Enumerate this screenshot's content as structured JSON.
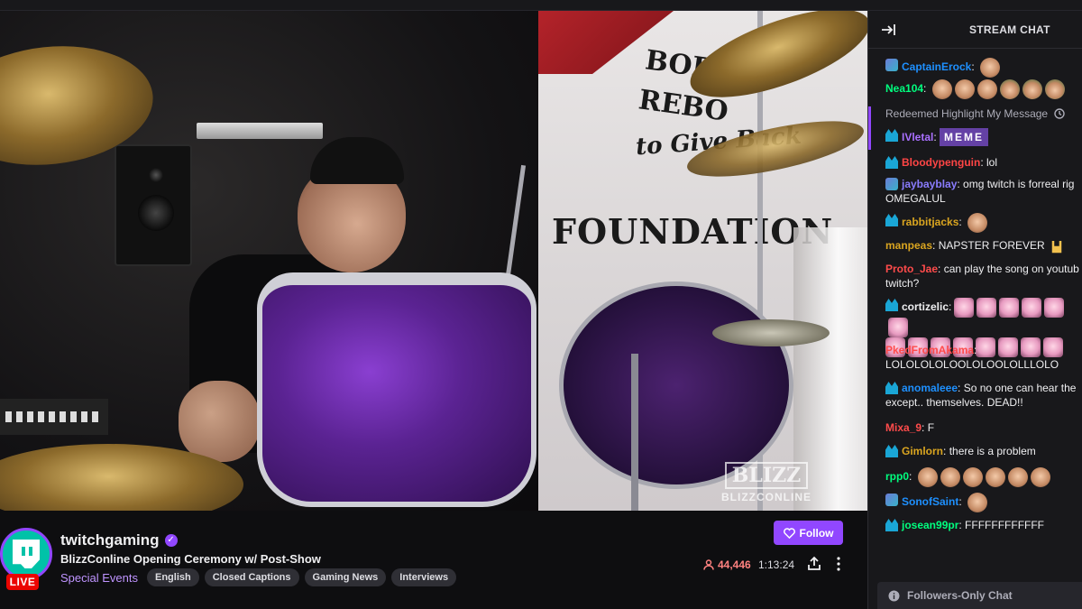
{
  "video": {
    "banner_lines": [
      "BORN 19",
      "REBO",
      "to Give Back",
      "FOUNDATION"
    ],
    "watermark_text": "BLIZZCONLINE",
    "watermark_mark": "BLIZZ"
  },
  "channel": {
    "name": "twitchgaming",
    "live_label": "LIVE",
    "title": "BlizzConline Opening Ceremony w/ Post-Show",
    "category": "Special Events",
    "tags": [
      "English",
      "Closed Captions",
      "Gaming News",
      "Interviews"
    ],
    "follow_label": "Follow",
    "viewer_count": "44,446",
    "uptime": "1:13:24"
  },
  "chat": {
    "title": "STREAM CHAT",
    "redeem_text": "Redeemed Highlight My Message",
    "messages": [
      {
        "user": "CaptainErock",
        "color": "#1e90ff",
        "text": "",
        "badge": "sub",
        "emotes": 1
      },
      {
        "user": "Nea104",
        "color": "#00ff7f",
        "text": "",
        "badge": "",
        "emotes": 6
      },
      {
        "user": "IVletal",
        "color": "#a970ff",
        "text": "MEME",
        "badge": "prime",
        "emotes": 0
      },
      {
        "user": "Bloodypenguin",
        "color": "#ff4545",
        "text": "lol",
        "badge": "prime",
        "emotes": 0
      },
      {
        "user": "jaybayblay",
        "color": "#8a7cff",
        "text": "omg twitch is forreal rig",
        "text2": "OMEGALUL",
        "badge": "sub",
        "emotes": 0
      },
      {
        "user": "rabbitjacks",
        "color": "#daa520",
        "text": "",
        "badge": "prime",
        "emotes": 1
      },
      {
        "user": "manpeas",
        "color": "#daa520",
        "text": "NAPSTER FOREVER",
        "badge": "",
        "emotes": 0
      },
      {
        "user": "Proto_Jae",
        "color": "#ff4b4b",
        "text": "can play the song on youtub",
        "text2": "twitch?",
        "badge": "",
        "emotes": 0
      },
      {
        "user": "cortizelic",
        "color": "#efeff1",
        "text": "",
        "badge": "prime",
        "emotes": 13
      },
      {
        "user": "PkedFromAkama",
        "color": "#ff4b4b",
        "text": "",
        "text2": "LOLOLOLOLOOLOLOOLOLLLOLO",
        "badge": "",
        "emotes": 0
      },
      {
        "user": "anomaleee",
        "color": "#1e90ff",
        "text": "So no one can hear the",
        "text2": "except.. themselves. DEAD!!",
        "badge": "prime",
        "emotes": 0
      },
      {
        "user": "Mixa_9",
        "color": "#ff4b4b",
        "text": "F",
        "badge": "",
        "emotes": 0
      },
      {
        "user": "Gimlorn",
        "color": "#daa520",
        "text": "there is a problem",
        "badge": "prime",
        "emotes": 0
      },
      {
        "user": "rpp0",
        "color": "#00ff7f",
        "text": "",
        "badge": "",
        "emotes": 6
      },
      {
        "user": "SonofSaint",
        "color": "#1e90ff",
        "text": "",
        "badge": "sub",
        "emotes": 1
      },
      {
        "user": "josean99pr",
        "color": "#00ff7f",
        "text": "FFFFFFFFFFFF",
        "badge": "prime",
        "emotes": 0
      }
    ],
    "followers_only_label": "Followers-Only Chat"
  },
  "colors": {
    "accent": "#9147ff",
    "live": "#eb0400",
    "viewers": "#ff8280",
    "category": "#bf94ff"
  },
  "icons": [
    "collapse-arrow-icon",
    "heart-icon",
    "person-icon",
    "share-icon",
    "more-icon",
    "clock-icon",
    "info-icon",
    "verified-icon"
  ]
}
